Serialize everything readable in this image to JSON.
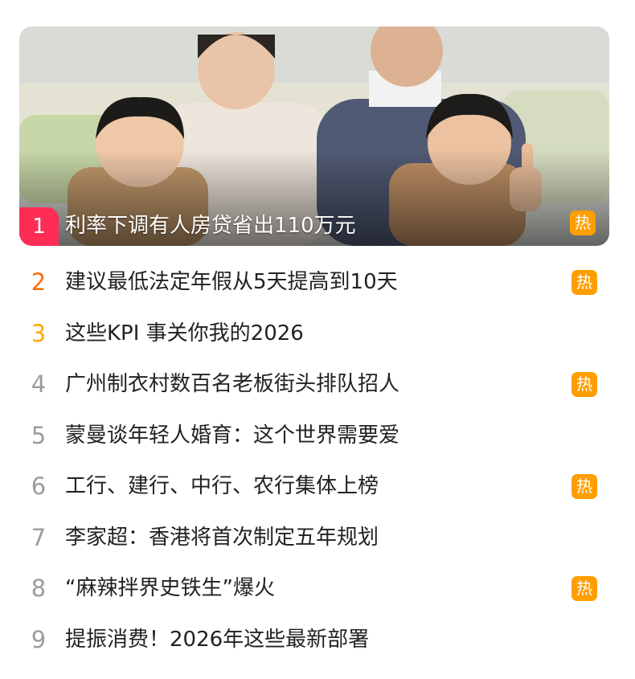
{
  "hero": {
    "rank": "1",
    "title": "利率下调有人房贷省出110万元",
    "badge": "热"
  },
  "items": [
    {
      "rank": "2",
      "title": "建议最低法定年假从5天提高到10天",
      "badge": "热"
    },
    {
      "rank": "3",
      "title": "这些KPI 事关你我的2026",
      "badge": ""
    },
    {
      "rank": "4",
      "title": "广州制衣村数百名老板街头排队招人",
      "badge": "热"
    },
    {
      "rank": "5",
      "title": "蒙曼谈年轻人婚育：这个世界需要爱",
      "badge": ""
    },
    {
      "rank": "6",
      "title": "工行、建行、中行、农行集体上榜",
      "badge": "热"
    },
    {
      "rank": "7",
      "title": "李家超：香港将首次制定五年规划",
      "badge": ""
    },
    {
      "rank": "8",
      "title": "“麻辣拌界史铁生”爆火",
      "badge": "热"
    },
    {
      "rank": "9",
      "title": "提振消费！2026年这些最新部署",
      "badge": ""
    }
  ],
  "colors": {
    "rank1": "#fe2d55",
    "rank2": "#ff6a00",
    "rank3": "#ffa800",
    "rank_other": "#9a9ca2",
    "hot_badge": "#ff9e00"
  }
}
